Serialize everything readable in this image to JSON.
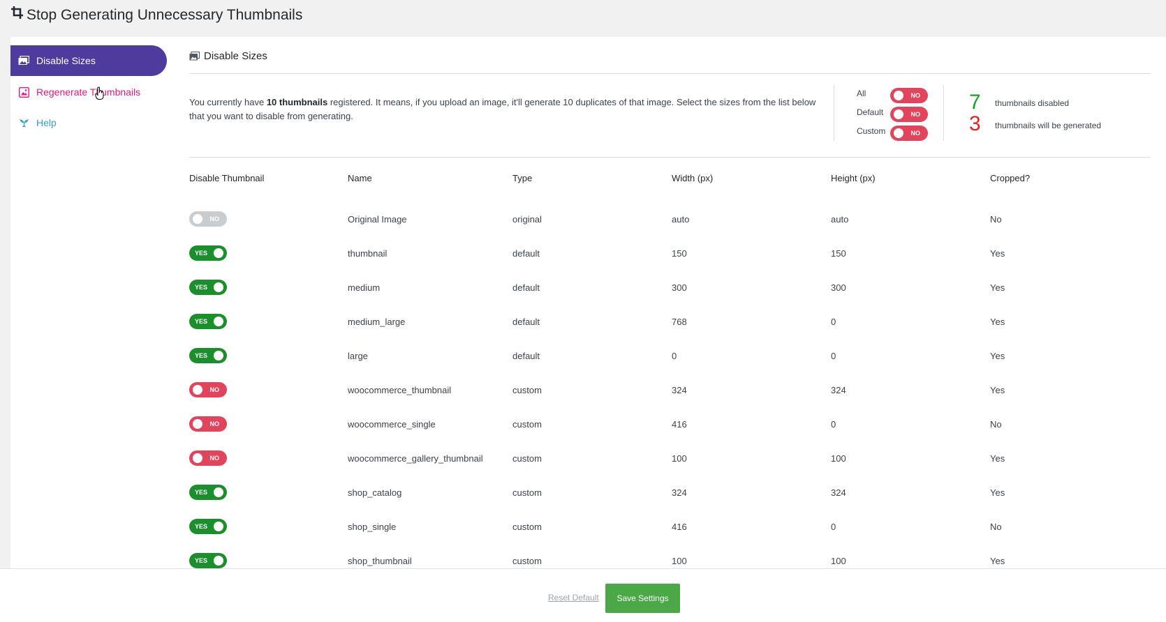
{
  "page": {
    "title": "Stop Generating Unnecessary Thumbnails"
  },
  "sidebar": {
    "items": [
      {
        "label": "Disable Sizes",
        "icon": "images-icon",
        "active": true
      },
      {
        "label": "Regenerate Thumbnails",
        "icon": "image-icon",
        "active": false
      },
      {
        "label": "Help",
        "icon": "lifebuoy-icon",
        "active": false
      }
    ]
  },
  "section": {
    "title": "Disable Sizes"
  },
  "intro": {
    "prefix": "You currently have ",
    "bold": "10 thumbnails",
    "suffix": " registered. It means, if you upload an image, it'll generate 10 duplicates of that image. Select the sizes from the list below that you want to disable from generating."
  },
  "bulk": [
    {
      "label": "All",
      "state": "NO"
    },
    {
      "label": "Default",
      "state": "NO"
    },
    {
      "label": "Custom",
      "state": "NO"
    }
  ],
  "stats": {
    "disabled_count": "7",
    "disabled_label": "thumbnails disabled",
    "generated_count": "3",
    "generated_label": "thumbnails will be generated"
  },
  "table": {
    "headers": [
      "Disable Thumbnail",
      "Name",
      "Type",
      "Width (px)",
      "Height (px)",
      "Cropped?"
    ],
    "rows": [
      {
        "toggle": "NO",
        "name": "Original Image",
        "type": "original",
        "width": "auto",
        "height": "auto",
        "cropped": "No"
      },
      {
        "toggle": "YES",
        "name": "thumbnail",
        "type": "default",
        "width": "150",
        "height": "150",
        "cropped": "Yes"
      },
      {
        "toggle": "YES",
        "name": "medium",
        "type": "default",
        "width": "300",
        "height": "300",
        "cropped": "Yes"
      },
      {
        "toggle": "YES",
        "name": "medium_large",
        "type": "default",
        "width": "768",
        "height": "0",
        "cropped": "Yes"
      },
      {
        "toggle": "YES",
        "name": "large",
        "type": "default",
        "width": "0",
        "height": "0",
        "cropped": "Yes"
      },
      {
        "toggle": "NO",
        "name": "woocommerce_thumbnail",
        "type": "custom",
        "width": "324",
        "height": "324",
        "cropped": "Yes"
      },
      {
        "toggle": "NO",
        "name": "woocommerce_single",
        "type": "custom",
        "width": "416",
        "height": "0",
        "cropped": "No"
      },
      {
        "toggle": "NO",
        "name": "woocommerce_gallery_thumbnail",
        "type": "custom",
        "width": "100",
        "height": "100",
        "cropped": "Yes"
      },
      {
        "toggle": "YES",
        "name": "shop_catalog",
        "type": "custom",
        "width": "324",
        "height": "324",
        "cropped": "Yes"
      },
      {
        "toggle": "YES",
        "name": "shop_single",
        "type": "custom",
        "width": "416",
        "height": "0",
        "cropped": "No"
      },
      {
        "toggle": "YES",
        "name": "shop_thumbnail",
        "type": "custom",
        "width": "100",
        "height": "100",
        "cropped": "Yes"
      }
    ]
  },
  "footer": {
    "reset_label": "Reset Default",
    "save_label": "Save Settings"
  },
  "colors": {
    "accent": "#4f3a9e",
    "yes": "#1a8f2b",
    "no": "#e2445c",
    "stat_disabled": "#1f9e2f",
    "stat_generated": "#e02424",
    "save": "#4aa846"
  }
}
